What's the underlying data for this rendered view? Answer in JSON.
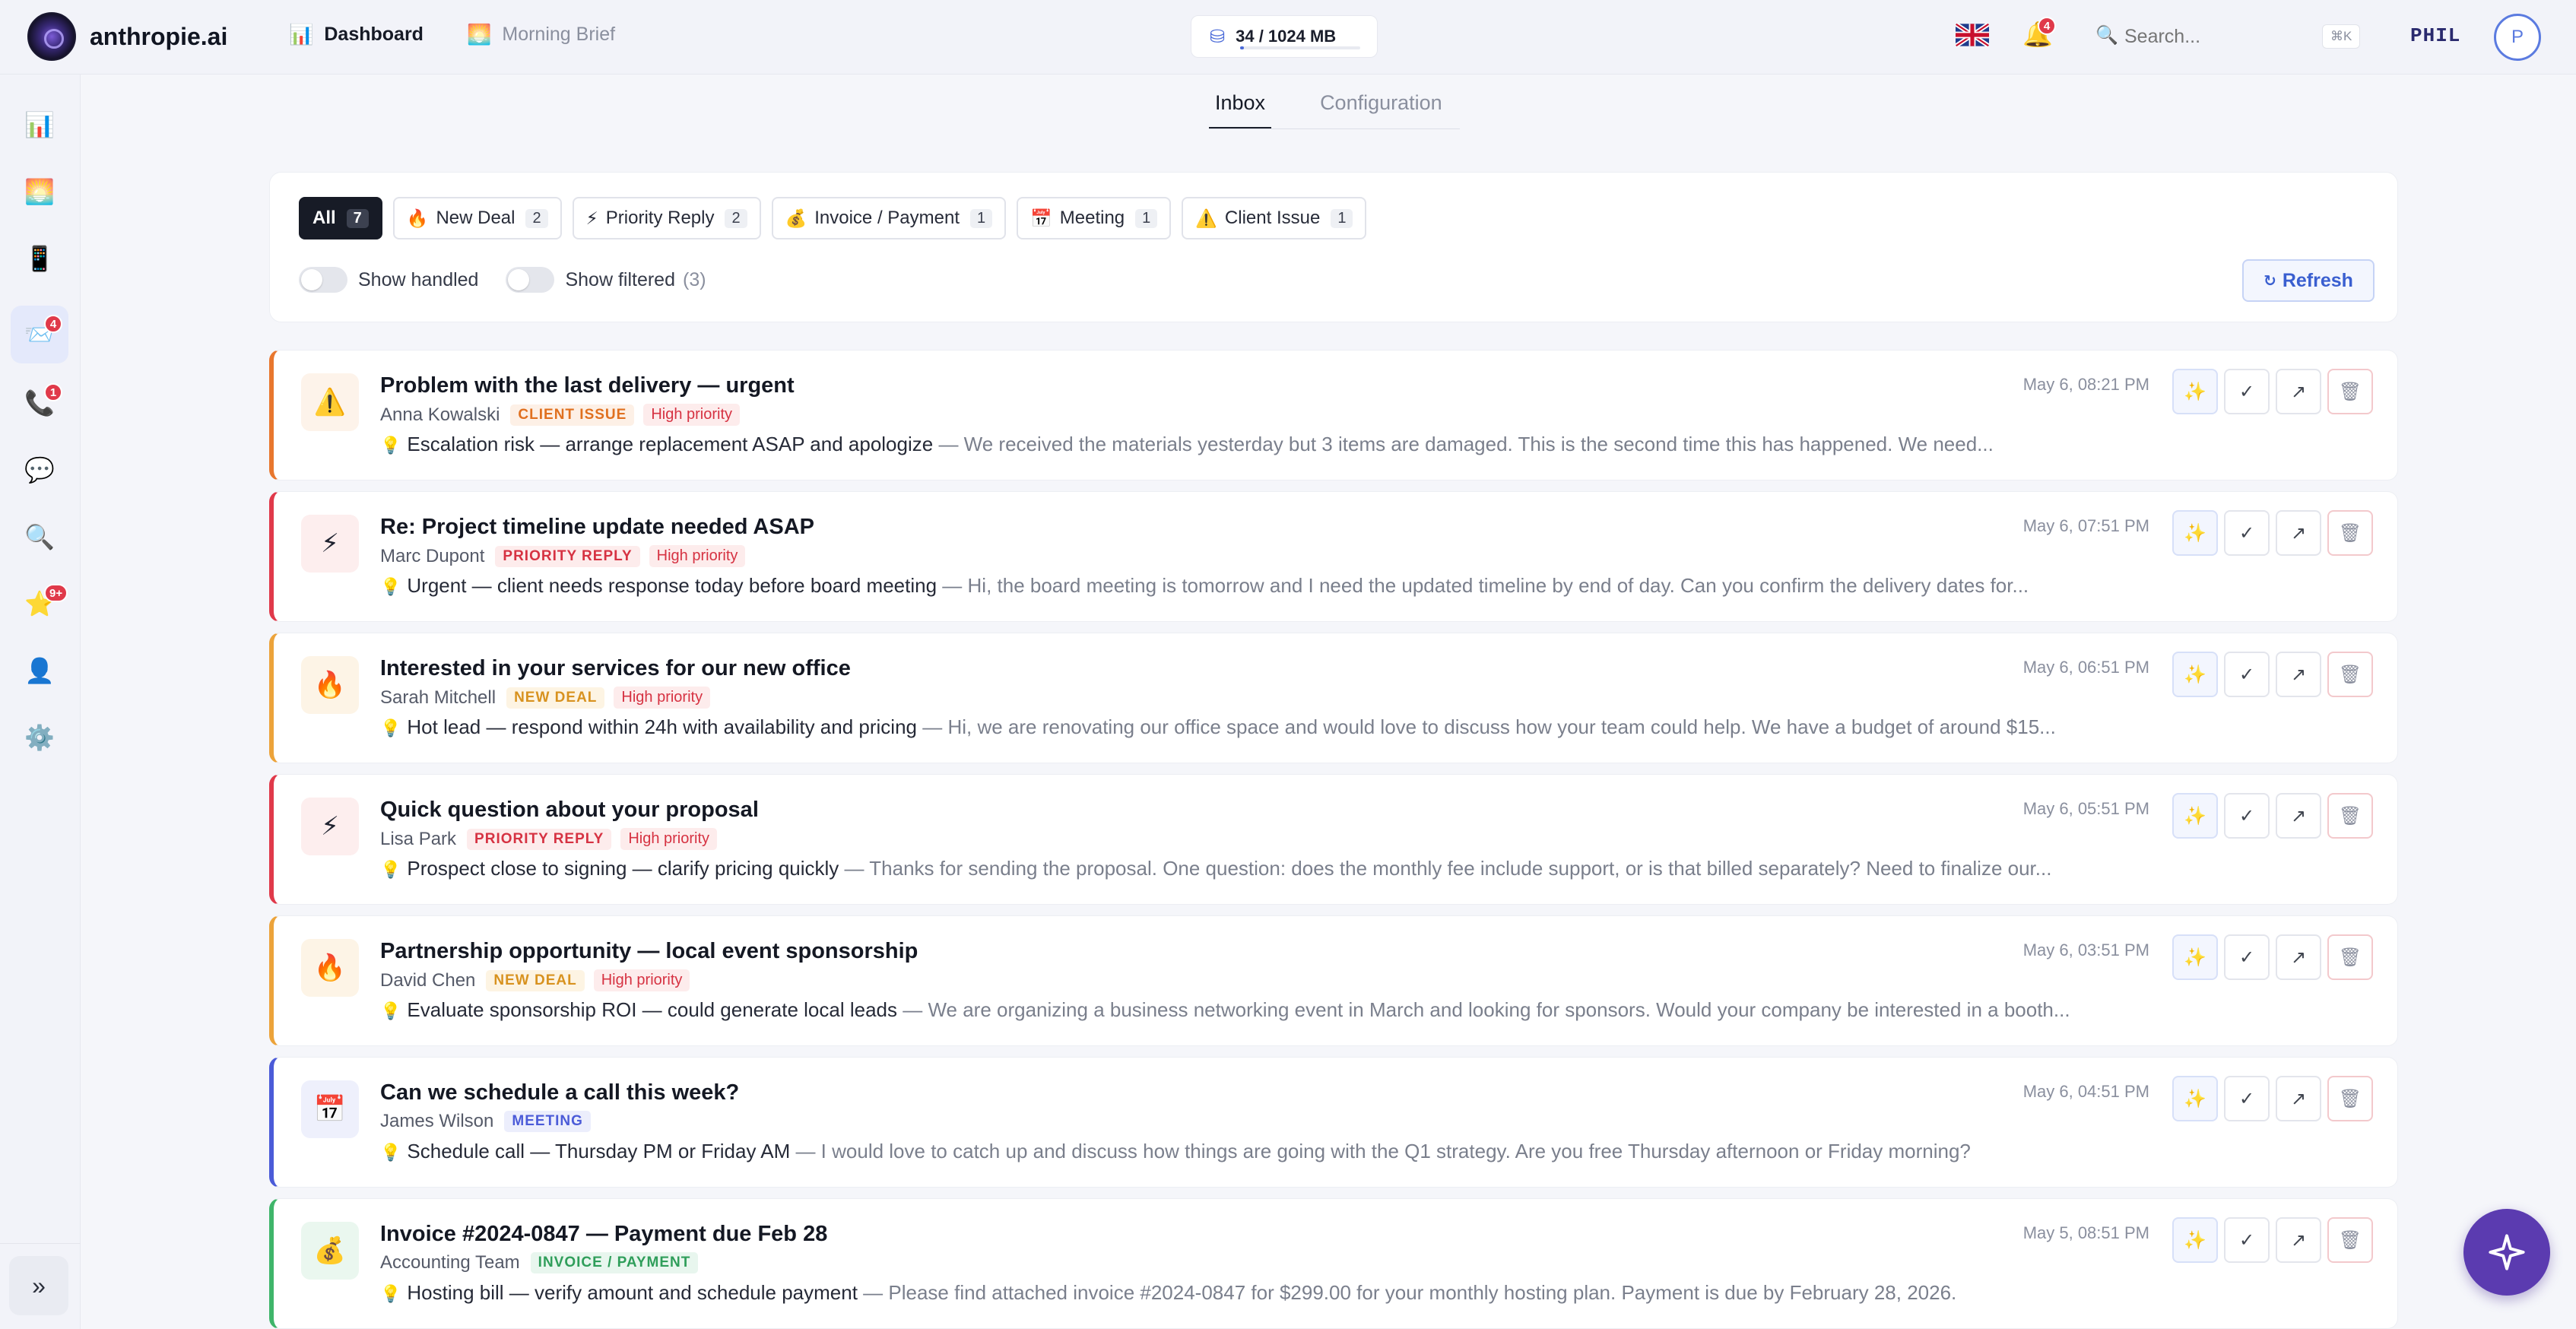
{
  "brand": {
    "name": "anthropie.ai"
  },
  "nav": [
    {
      "label": "Dashboard",
      "icon": "📊",
      "active": true
    },
    {
      "label": "Morning Brief",
      "icon": "🌅",
      "active": false
    }
  ],
  "storage": {
    "label": "34 / 1024 MB",
    "used_fraction": 0.033
  },
  "header": {
    "notifications_count": "4",
    "search_placeholder": "Search...",
    "shortcut": "⌘K",
    "username": "PHIL",
    "avatar_initial": "P"
  },
  "sidebar": {
    "items": [
      {
        "name": "dashboard",
        "icon": "📊",
        "badge": ""
      },
      {
        "name": "morning-brief",
        "icon": "🌅",
        "badge": ""
      },
      {
        "name": "mobile",
        "icon": "📱",
        "badge": ""
      },
      {
        "name": "inbox",
        "icon": "📨",
        "badge": "4",
        "active": true
      },
      {
        "name": "calls",
        "icon": "📞",
        "badge": "1"
      },
      {
        "name": "messages",
        "icon": "💬",
        "badge": ""
      },
      {
        "name": "search",
        "icon": "🔍",
        "badge": ""
      },
      {
        "name": "favorites",
        "icon": "⭐",
        "badge": "9+"
      },
      {
        "name": "contacts",
        "icon": "👤",
        "badge": ""
      },
      {
        "name": "settings",
        "icon": "⚙️",
        "badge": ""
      }
    ],
    "collapse_label": "»"
  },
  "tabs": [
    {
      "label": "Inbox",
      "active": true
    },
    {
      "label": "Configuration",
      "active": false
    }
  ],
  "filters": {
    "chips": [
      {
        "label": "All",
        "icon": "",
        "count": "7",
        "active": true
      },
      {
        "label": "New Deal",
        "icon": "🔥",
        "count": "2"
      },
      {
        "label": "Priority Reply",
        "icon": "⚡",
        "count": "2"
      },
      {
        "label": "Invoice / Payment",
        "icon": "💰",
        "count": "1"
      },
      {
        "label": "Meeting",
        "icon": "📅",
        "count": "1"
      },
      {
        "label": "Client Issue",
        "icon": "⚠️",
        "count": "1"
      }
    ],
    "show_handled": "Show handled",
    "show_filtered": "Show filtered",
    "filtered_count": "(3)",
    "refresh_label": "Refresh",
    "refresh_icon": "↻"
  },
  "emails": [
    {
      "type": "issue",
      "icon": "⚠️",
      "subject": "Problem with the last delivery — urgent",
      "sender": "Anna Kowalski",
      "tag": "CLIENT ISSUE",
      "priority": "High priority",
      "headline": "Escalation risk — arrange replacement ASAP and apologize",
      "preview": " — We received the materials yesterday but 3 items are damaged. This is the second time this has happened. We need...",
      "time": "May 6, 08:21 PM"
    },
    {
      "type": "priority",
      "icon": "⚡",
      "subject": "Re: Project timeline update needed ASAP",
      "sender": "Marc Dupont",
      "tag": "PRIORITY REPLY",
      "priority": "High priority",
      "headline": "Urgent — client needs response today before board meeting",
      "preview": " — Hi, the board meeting is tomorrow and I need the updated timeline by end of day. Can you confirm the delivery dates for...",
      "time": "May 6, 07:51 PM"
    },
    {
      "type": "deal",
      "icon": "🔥",
      "subject": "Interested in your services for our new office",
      "sender": "Sarah Mitchell",
      "tag": "NEW DEAL",
      "priority": "High priority",
      "headline": "Hot lead — respond within 24h with availability and pricing",
      "preview": " — Hi, we are renovating our office space and would love to discuss how your team could help. We have a budget of around $15...",
      "time": "May 6, 06:51 PM"
    },
    {
      "type": "priority",
      "icon": "⚡",
      "subject": "Quick question about your proposal",
      "sender": "Lisa Park",
      "tag": "PRIORITY REPLY",
      "priority": "High priority",
      "headline": "Prospect close to signing — clarify pricing quickly",
      "preview": " — Thanks for sending the proposal. One question: does the monthly fee include support, or is that billed separately? Need to finalize our...",
      "time": "May 6, 05:51 PM"
    },
    {
      "type": "deal",
      "icon": "🔥",
      "subject": "Partnership opportunity — local event sponsorship",
      "sender": "David Chen",
      "tag": "NEW DEAL",
      "priority": "High priority",
      "headline": "Evaluate sponsorship ROI — could generate local leads",
      "preview": " — We are organizing a business networking event in March and looking for sponsors. Would your company be interested in a booth...",
      "time": "May 6, 03:51 PM"
    },
    {
      "type": "meeting",
      "icon": "📅",
      "subject": "Can we schedule a call this week?",
      "sender": "James Wilson",
      "tag": "MEETING",
      "priority": "",
      "headline": "Schedule call — Thursday PM or Friday AM",
      "preview": " — I would love to catch up and discuss how things are going with the Q1 strategy. Are you free Thursday afternoon or Friday morning?",
      "time": "May 6, 04:51 PM"
    },
    {
      "type": "invoice",
      "icon": "💰",
      "subject": "Invoice #2024-0847 — Payment due Feb 28",
      "sender": "Accounting Team",
      "tag": "INVOICE / PAYMENT",
      "priority": "",
      "headline": "Hosting bill — verify amount and schedule payment",
      "preview": " — Please find attached invoice #2024-0847 for $299.00 for your monthly hosting plan. Payment is due by February 28, 2026.",
      "time": "May 5, 08:51 PM"
    }
  ],
  "actions": {
    "ai": "✨",
    "done": "✓",
    "open": "↗",
    "delete": "🗑"
  },
  "colors": {
    "accent": "#4a6ad8",
    "fab": "#5b3bb0",
    "danger": "#e0394a"
  }
}
